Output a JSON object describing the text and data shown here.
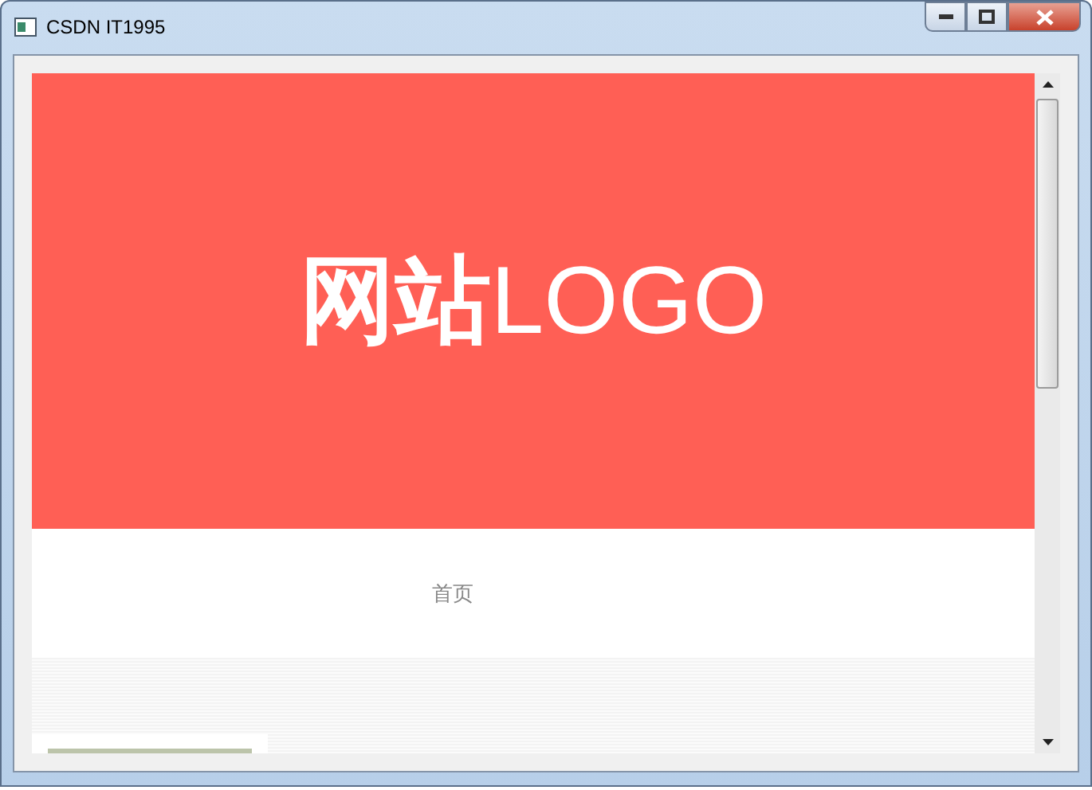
{
  "window": {
    "title": "CSDN IT1995"
  },
  "banner": {
    "logo": "**网站**LOGO"
  },
  "nav": {
    "items": [
      {
        "label": "首页"
      }
    ]
  }
}
